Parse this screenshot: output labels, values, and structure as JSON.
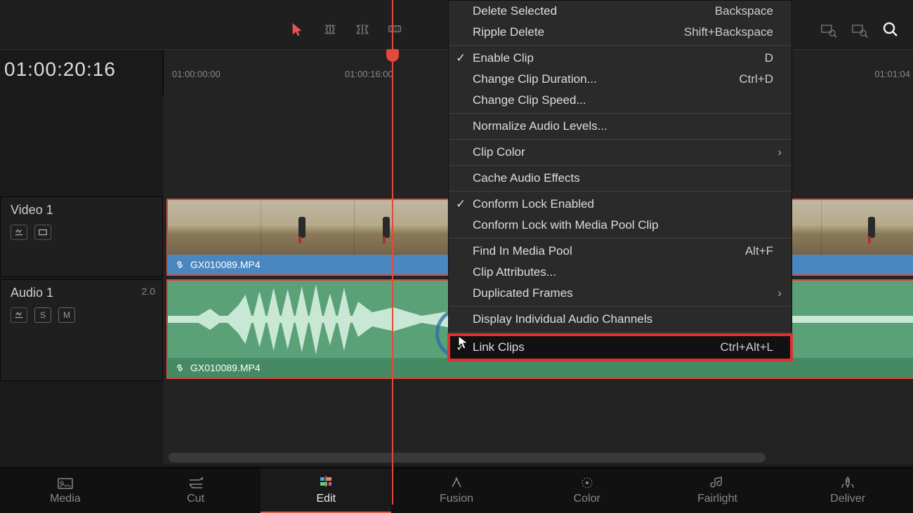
{
  "timecode": "01:00:20:16",
  "ruler": {
    "tc1": "01:00:00:00",
    "tc2": "01:00:16:00",
    "tc3": "01:01:04"
  },
  "tracks": {
    "video": {
      "name": "Video 1",
      "clip_name": "GX010089.MP4"
    },
    "audio": {
      "name": "Audio 1",
      "channels": "2.0",
      "clip_name": "GX010089.MP4",
      "solo": "S",
      "mute": "M"
    }
  },
  "menu": {
    "delete_selected": "Delete Selected",
    "delete_selected_key": "Backspace",
    "ripple_delete": "Ripple Delete",
    "ripple_delete_key": "Shift+Backspace",
    "enable_clip": "Enable Clip",
    "enable_clip_key": "D",
    "change_duration": "Change Clip Duration...",
    "change_duration_key": "Ctrl+D",
    "change_speed": "Change Clip Speed...",
    "normalize": "Normalize Audio Levels...",
    "clip_color": "Clip Color",
    "cache_audio": "Cache Audio Effects",
    "conform_lock": "Conform Lock Enabled",
    "conform_pool": "Conform Lock with Media Pool Clip",
    "find_pool": "Find In Media Pool",
    "find_pool_key": "Alt+F",
    "clip_attrs": "Clip Attributes...",
    "dup_frames": "Duplicated Frames",
    "display_channels": "Display Individual Audio Channels",
    "link_clips": "Link Clips",
    "link_clips_key": "Ctrl+Alt+L"
  },
  "pages": {
    "media": "Media",
    "cut": "Cut",
    "edit": "Edit",
    "fusion": "Fusion",
    "color": "Color",
    "fairlight": "Fairlight",
    "deliver": "Deliver"
  }
}
